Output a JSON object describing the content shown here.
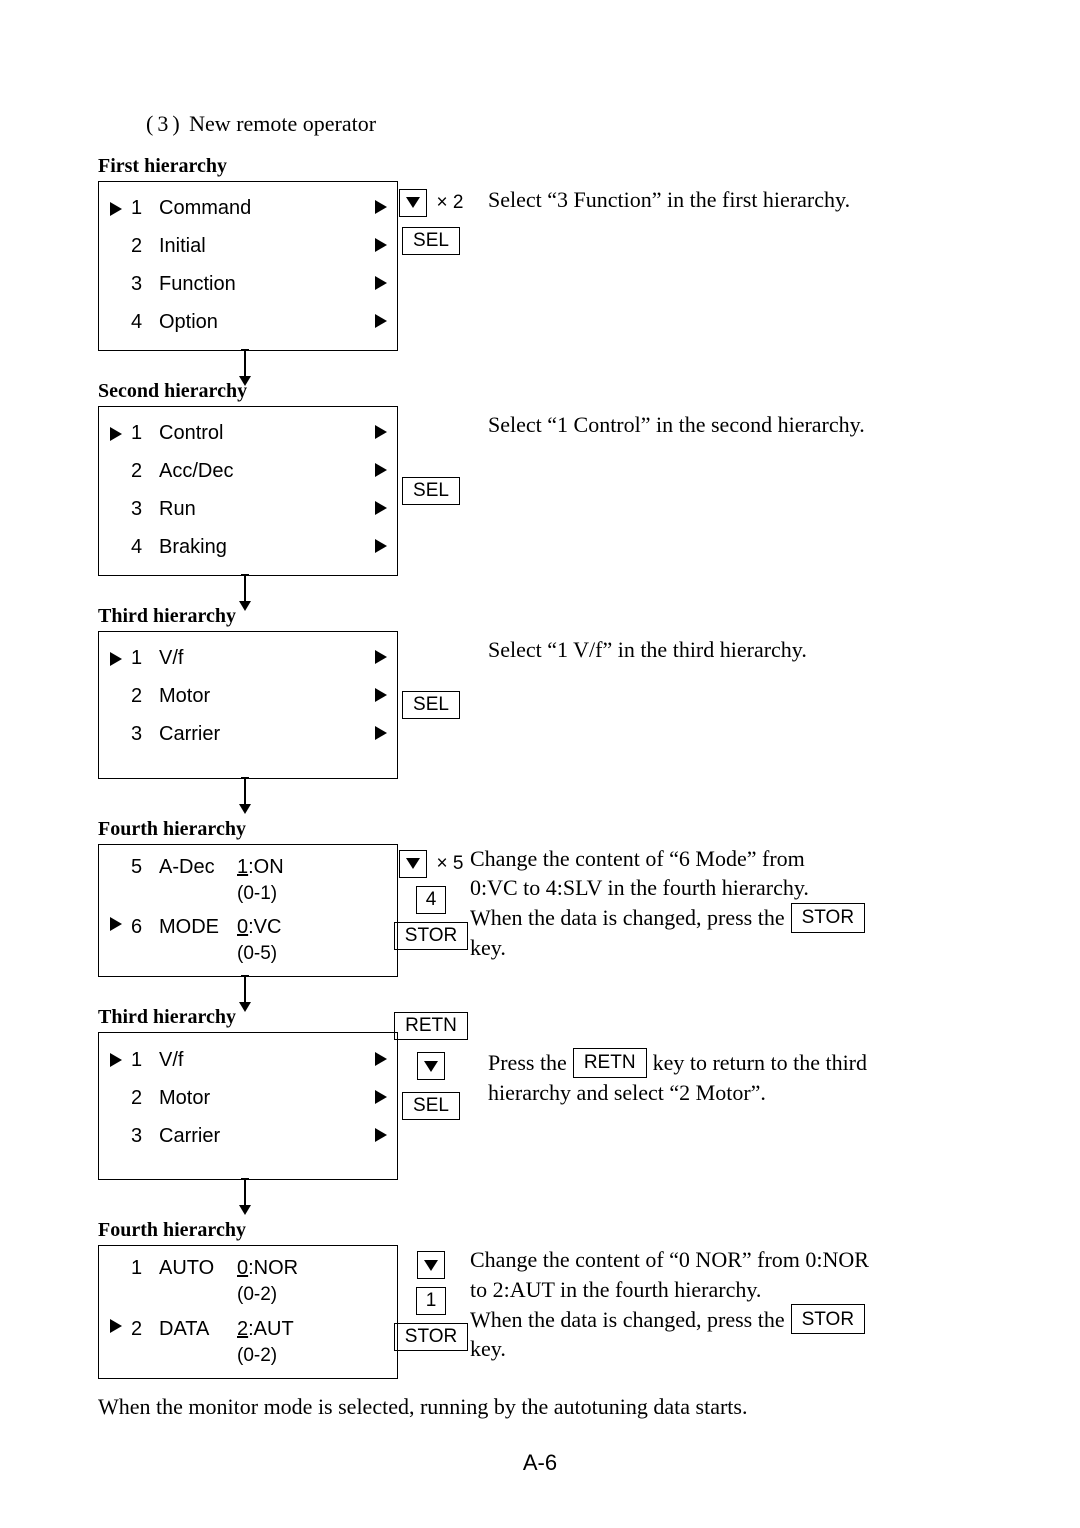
{
  "section_number": "(3)",
  "section_title": "New remote operator",
  "labels": {
    "first_h": "First hierarchy",
    "second_h": "Second hierarchy",
    "third_h": "Third hierarchy",
    "fourth_h": "Fourth hierarchy"
  },
  "h1": {
    "items": [
      {
        "n": "1",
        "t": "Command"
      },
      {
        "n": "2",
        "t": "Initial"
      },
      {
        "n": "3",
        "t": "Function"
      },
      {
        "n": "4",
        "t": "Option"
      }
    ],
    "action_count": "× 2",
    "instruction": "Select “3 Function” in the first hierarchy."
  },
  "h2": {
    "items": [
      {
        "n": "1",
        "t": "Control"
      },
      {
        "n": "2",
        "t": "Acc/Dec"
      },
      {
        "n": "3",
        "t": "Run"
      },
      {
        "n": "4",
        "t": "Braking"
      }
    ],
    "instruction": "Select “1 Control” in the second hierarchy."
  },
  "h3a": {
    "items": [
      {
        "n": "1",
        "t": "V/f"
      },
      {
        "n": "2",
        "t": "Motor"
      },
      {
        "n": "3",
        "t": "Carrier"
      }
    ],
    "instruction": "Select “1 V/f” in the third hierarchy."
  },
  "h4a": {
    "rows": [
      {
        "cursor": false,
        "n": "5",
        "t": "A-Dec",
        "val_ul": "1",
        "val_rest": ":ON",
        "range": "(0-1)"
      },
      {
        "cursor": true,
        "n": "6",
        "t": "MODE",
        "val_ul": "0",
        "val_rest": ":VC",
        "range": "(0-5)"
      }
    ],
    "action_count": "× 5",
    "action_num": "4",
    "instruction_l1": "Change the content of “6 Mode” from",
    "instruction_l2": "0:VC to 4:SLV in the fourth hierarchy.",
    "instruction_l3a": "When the data is changed, press the",
    "instruction_l3b": "key."
  },
  "h3b": {
    "items": [
      {
        "n": "1",
        "t": "V/f"
      },
      {
        "n": "2",
        "t": "Motor"
      },
      {
        "n": "3",
        "t": "Carrier"
      }
    ],
    "instruction_a": "Press the",
    "instruction_b": "key to return to the third",
    "instruction_c": "hierarchy and select “2 Motor”."
  },
  "h4b": {
    "rows": [
      {
        "cursor": false,
        "n": "1",
        "t": "AUTO",
        "val_ul": "0",
        "val_rest": ":NOR",
        "range": "(0-2)"
      },
      {
        "cursor": true,
        "n": "2",
        "t": "DATA",
        "val_ul": "2",
        "val_rest": ":AUT",
        "range": "(0-2)"
      }
    ],
    "action_num": "1",
    "instruction_l1": "Change the content of “0 NOR” from 0:NOR",
    "instruction_l2": "to 2:AUT in the fourth hierarchy.",
    "instruction_l3a": "When the data is changed, press the",
    "instruction_l3b": "key."
  },
  "btn": {
    "sel": "SEL",
    "stor": "STOR",
    "retn": "RETN"
  },
  "footer": "When the monitor mode is selected, running by the autotuning data starts.",
  "page_num": "A-6"
}
